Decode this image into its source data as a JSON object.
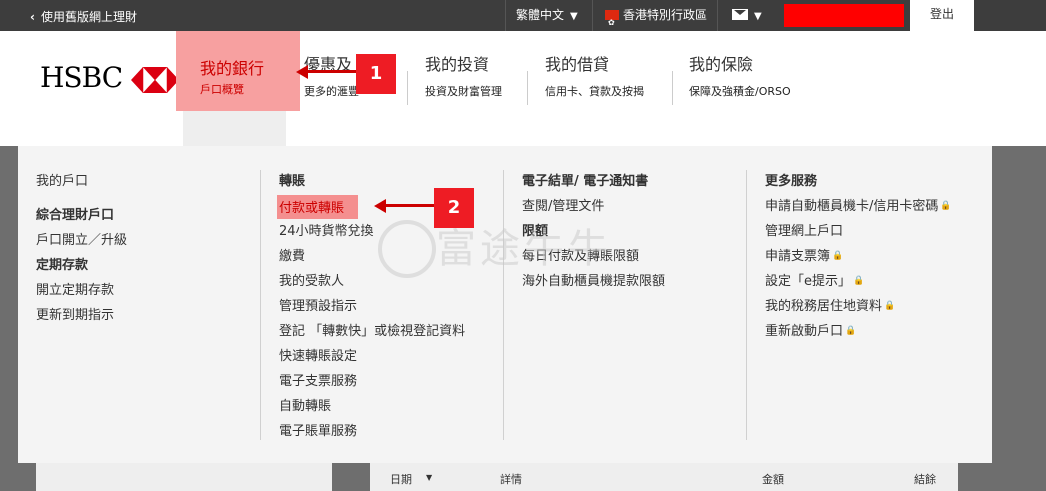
{
  "topbar": {
    "back_label": "使用舊版網上理財",
    "language": "繁體中文",
    "region": "香港特別行政區",
    "logout": "登出"
  },
  "header": {
    "logo": "HSBC",
    "nav": [
      {
        "title": "我的銀行",
        "sub": "戶口概覽"
      },
      {
        "title": "優惠及",
        "sub": "更多的滙豐"
      },
      {
        "title": "我的投資",
        "sub": "投資及財富管理"
      },
      {
        "title": "我的借貸",
        "sub": "信用卡、貸款及按揭"
      },
      {
        "title": "我的保險",
        "sub": "保障及強積金/ORSO"
      }
    ]
  },
  "annotations": {
    "one": "1",
    "two": "2"
  },
  "menu": {
    "col1": {
      "items": [
        "我的戶口"
      ],
      "head2": "綜合理財戶口",
      "items2": [
        "戶口開立／升級"
      ],
      "head3": "定期存款",
      "items3": [
        "開立定期存款",
        "更新到期指示"
      ]
    },
    "col2": {
      "head": "轉賬",
      "items": [
        "付款或轉賬",
        "24小時貨幣兌換",
        "繳費",
        "我的受款人",
        "管理預設指示",
        "登記 「轉數快」或檢視登記資料",
        "快速轉賬設定",
        "電子支票服務",
        "自動轉賬",
        "電子賬單服務"
      ]
    },
    "col3": {
      "head": "電子結單/ 電子通知書",
      "items": [
        "查閱/管理文件"
      ],
      "head2": "限額",
      "items2": [
        "每日付款及轉賬限額",
        "海外自動櫃員機提款限額"
      ]
    },
    "col4": {
      "head": "更多服務",
      "items": [
        "申請自動櫃員機卡/信用卡密碼",
        "管理網上戶口",
        "申請支票簿",
        "設定「e提示」",
        "我的稅務居住地資料",
        "重新啟動戶口"
      ]
    }
  },
  "watermark": "富途牛牛",
  "table_header": {
    "date": "日期",
    "details": "詳情",
    "amount": "金額",
    "balance": "結餘"
  }
}
